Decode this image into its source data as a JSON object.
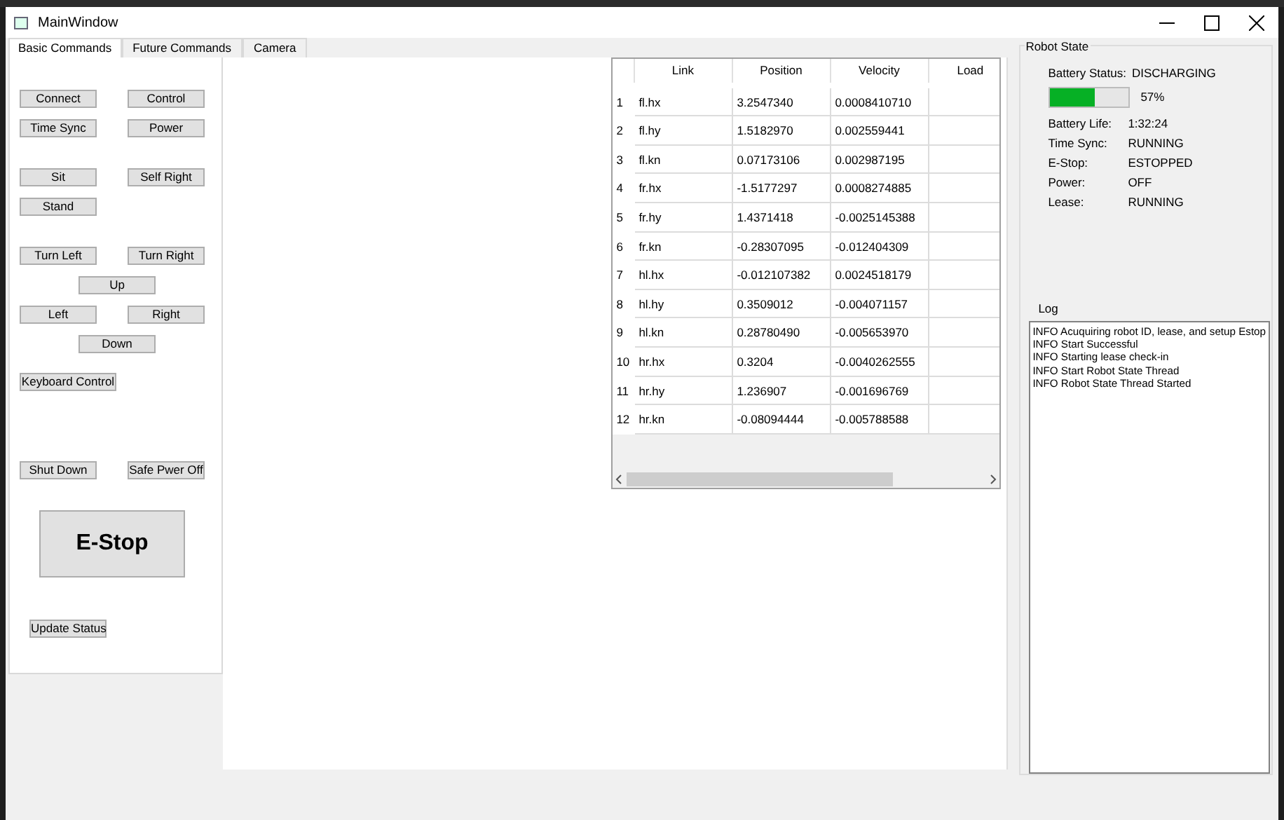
{
  "window": {
    "title": "MainWindow"
  },
  "tabs": [
    {
      "label": "Basic Commands",
      "selected": true
    },
    {
      "label": "Future Commands",
      "selected": false
    },
    {
      "label": "Camera",
      "selected": false
    }
  ],
  "button_rows": [
    [
      {
        "label": "Connect"
      },
      {
        "label": "Control"
      }
    ],
    [
      {
        "label": "Time Sync"
      },
      {
        "label": "Power"
      }
    ],
    [
      {
        "label": "Sit"
      },
      {
        "label": "Self Right"
      }
    ],
    [
      {
        "label": "Stand"
      }
    ],
    [
      {
        "label": "Turn Left"
      },
      {
        "label": "Turn Right"
      }
    ],
    [
      {
        "label": "Up"
      }
    ],
    [
      {
        "label": "Left"
      },
      {
        "label": "Right"
      }
    ],
    [
      {
        "label": "Down"
      }
    ],
    [
      {
        "label": "Keyboard Control"
      }
    ],
    [
      {
        "label": "Shut Down"
      },
      {
        "label": "Safe Pwer Off"
      }
    ]
  ],
  "estop_button": "E-Stop",
  "update_button": "Update Status",
  "table": {
    "columns": [
      "Link",
      "Position",
      "Velocity",
      "Load"
    ],
    "rows": [
      {
        "index": "1",
        "cells": [
          "fl.hx",
          "3.2547340",
          "0.0008410710"
        ]
      },
      {
        "index": "2",
        "cells": [
          "fl.hy",
          "1.5182970",
          "0.002559441"
        ]
      },
      {
        "index": "3",
        "cells": [
          "fl.kn",
          "0.07173106",
          "0.002987195"
        ]
      },
      {
        "index": "4",
        "cells": [
          "fr.hx",
          "-1.5177297",
          "0.0008274885"
        ]
      },
      {
        "index": "5",
        "cells": [
          "fr.hy",
          "1.4371418",
          "-0.0025145388"
        ]
      },
      {
        "index": "6",
        "cells": [
          "fr.kn",
          "-0.28307095",
          "-0.012404309"
        ]
      },
      {
        "index": "7",
        "cells": [
          "hl.hx",
          "-0.012107382",
          "0.0024518179"
        ]
      },
      {
        "index": "8",
        "cells": [
          "hl.hy",
          "0.3509012",
          "-0.004071157"
        ]
      },
      {
        "index": "9",
        "cells": [
          "hl.kn",
          "0.28780490",
          "-0.005653970"
        ]
      },
      {
        "index": "10",
        "cells": [
          "hr.hx",
          "0.3204",
          "-0.0040262555"
        ]
      },
      {
        "index": "11",
        "cells": [
          "hr.hy",
          "1.236907",
          "-0.001696769"
        ]
      },
      {
        "index": "12",
        "cells": [
          "hr.kn",
          "-0.08094444",
          "-0.005788588"
        ]
      }
    ]
  },
  "robot_state": {
    "title": "Robot State",
    "battery_status": {
      "label": "Battery Status:",
      "value": "DISCHARGING"
    },
    "battery": {
      "level": 0.57,
      "reading": "57%"
    },
    "fields": [
      {
        "label": "Battery Life:",
        "value": "1:32:24"
      },
      {
        "label": "Time Sync:",
        "value": "RUNNING"
      },
      {
        "label": "E-Stop:",
        "value": "ESTOPPED"
      },
      {
        "label": "Power:",
        "value": "OFF"
      },
      {
        "label": "Lease:",
        "value": "RUNNING"
      }
    ]
  },
  "log": {
    "title": "Log",
    "lines": [
      "INFO Acuquiring robot ID, lease, and setup Estop",
      "INFO Start Successful",
      "INFO Starting lease check-in",
      "INFO Start Robot State Thread",
      "INFO Robot State Thread Started"
    ]
  }
}
